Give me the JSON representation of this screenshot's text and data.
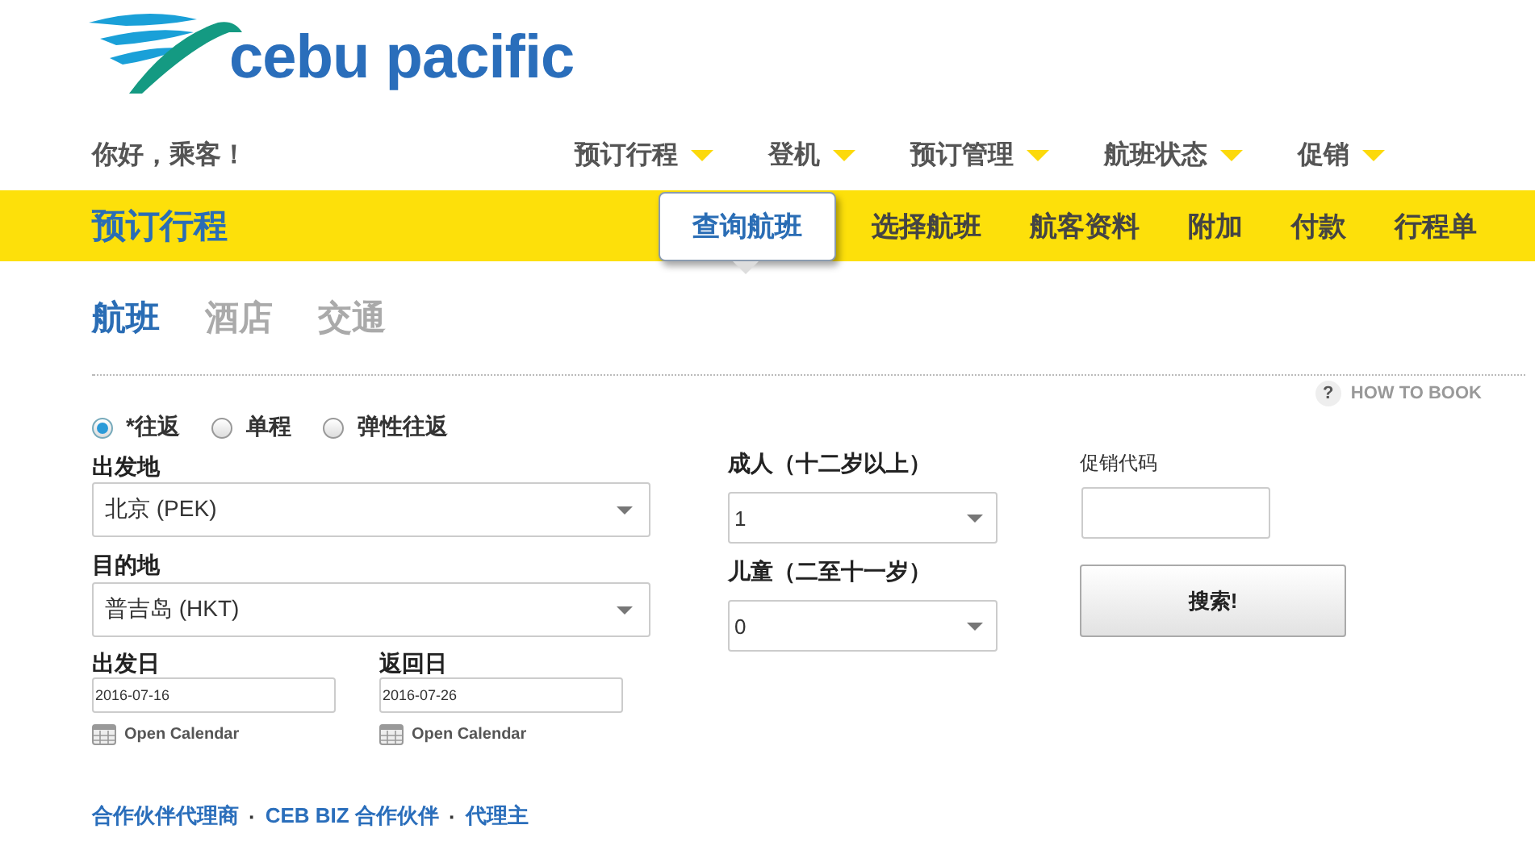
{
  "logo": {
    "text": "cebu pacific"
  },
  "greeting": "你好，乘客！",
  "main_nav": [
    {
      "label": "预订行程"
    },
    {
      "label": "登机"
    },
    {
      "label": "预订管理"
    },
    {
      "label": "航班状态"
    },
    {
      "label": "促销"
    }
  ],
  "booking_bar": {
    "title": "预订行程",
    "steps": [
      {
        "label": "查询航班",
        "selected": true
      },
      {
        "label": "选择航班",
        "selected": false
      },
      {
        "label": "航客资料",
        "selected": false
      },
      {
        "label": "附加",
        "selected": false
      },
      {
        "label": "付款",
        "selected": false
      },
      {
        "label": "行程单",
        "selected": false
      }
    ]
  },
  "product_tabs": [
    {
      "label": "航班",
      "selected": true
    },
    {
      "label": "酒店",
      "selected": false
    },
    {
      "label": "交通",
      "selected": false
    }
  ],
  "help_link": {
    "icon": "?",
    "label": "HOW TO BOOK"
  },
  "trip_types": [
    {
      "label": "*往返",
      "selected": true
    },
    {
      "label": "单程",
      "selected": false
    },
    {
      "label": "弹性往返",
      "selected": false
    }
  ],
  "origin": {
    "label": "出发地",
    "value": "北京 (PEK)"
  },
  "destination": {
    "label": "目的地",
    "value": "普吉岛 (HKT)"
  },
  "departure_date": {
    "label": "出发日",
    "value": "2016-07-16",
    "calendar_link": "Open Calendar"
  },
  "return_date": {
    "label": "返回日",
    "value": "2016-07-26",
    "calendar_link": "Open Calendar"
  },
  "adults": {
    "label": "成人（十二岁以上）",
    "value": "1"
  },
  "children": {
    "label": "儿童（二至十一岁）",
    "value": "0"
  },
  "promo_code": {
    "label": "促销代码"
  },
  "search_button": "搜索!",
  "footer_links": [
    {
      "label": "合作伙伴代理商"
    },
    {
      "separator": "·",
      "label": "CEB BIZ 合作伙伴"
    },
    {
      "separator": "·",
      "label": "代理主"
    }
  ]
}
